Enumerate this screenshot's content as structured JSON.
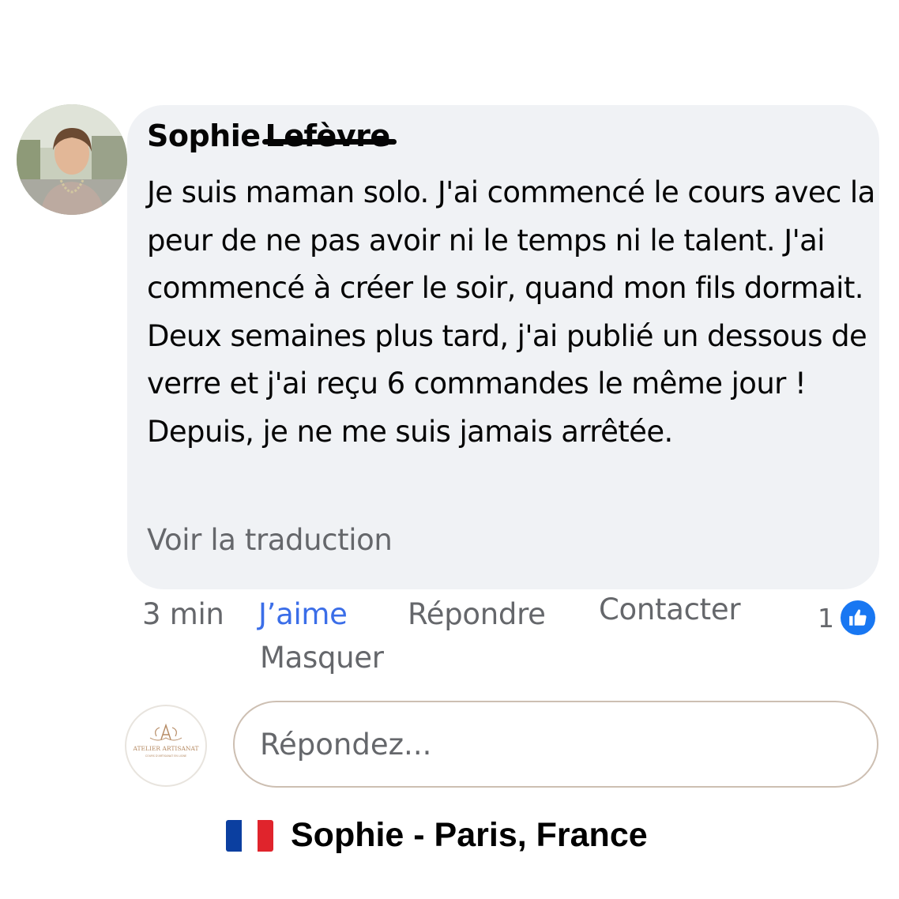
{
  "comment": {
    "author_first": "Sophie",
    "author_last": "Lefèvre",
    "text": "Je suis maman solo. J'ai commencé le cours avec la peur de ne pas avoir ni le temps ni le talent. J'ai commencé à créer le soir, quand mon fils dormait. Deux semaines plus tard, j'ai publié un dessous de verre et j'ai reçu 6 commandes le même jour ! Depuis, je ne me suis jamais arrêtée.",
    "translate_label": "Voir la traduction"
  },
  "actions": {
    "time": "3 min",
    "like": "J’aime",
    "reply": "Répondre",
    "contact": "Contacter",
    "hide": "Masquer",
    "like_count": "1"
  },
  "reply_box": {
    "placeholder": "Répondez...",
    "logo_title": "ATELIER ARTISANAT",
    "logo_subtitle": "COURS D'ARTISANAT EN LIGNE"
  },
  "footer": {
    "text": "Sophie - Paris, France",
    "flag_colors": [
      "#0b3fa0",
      "#ffffff",
      "#e0242c"
    ]
  },
  "colors": {
    "bubble": "#f0f2f5",
    "like_active": "#3b6ee8",
    "like_badge": "#1877f2"
  },
  "icons": {
    "like_badge": "thumbs-up-icon"
  }
}
